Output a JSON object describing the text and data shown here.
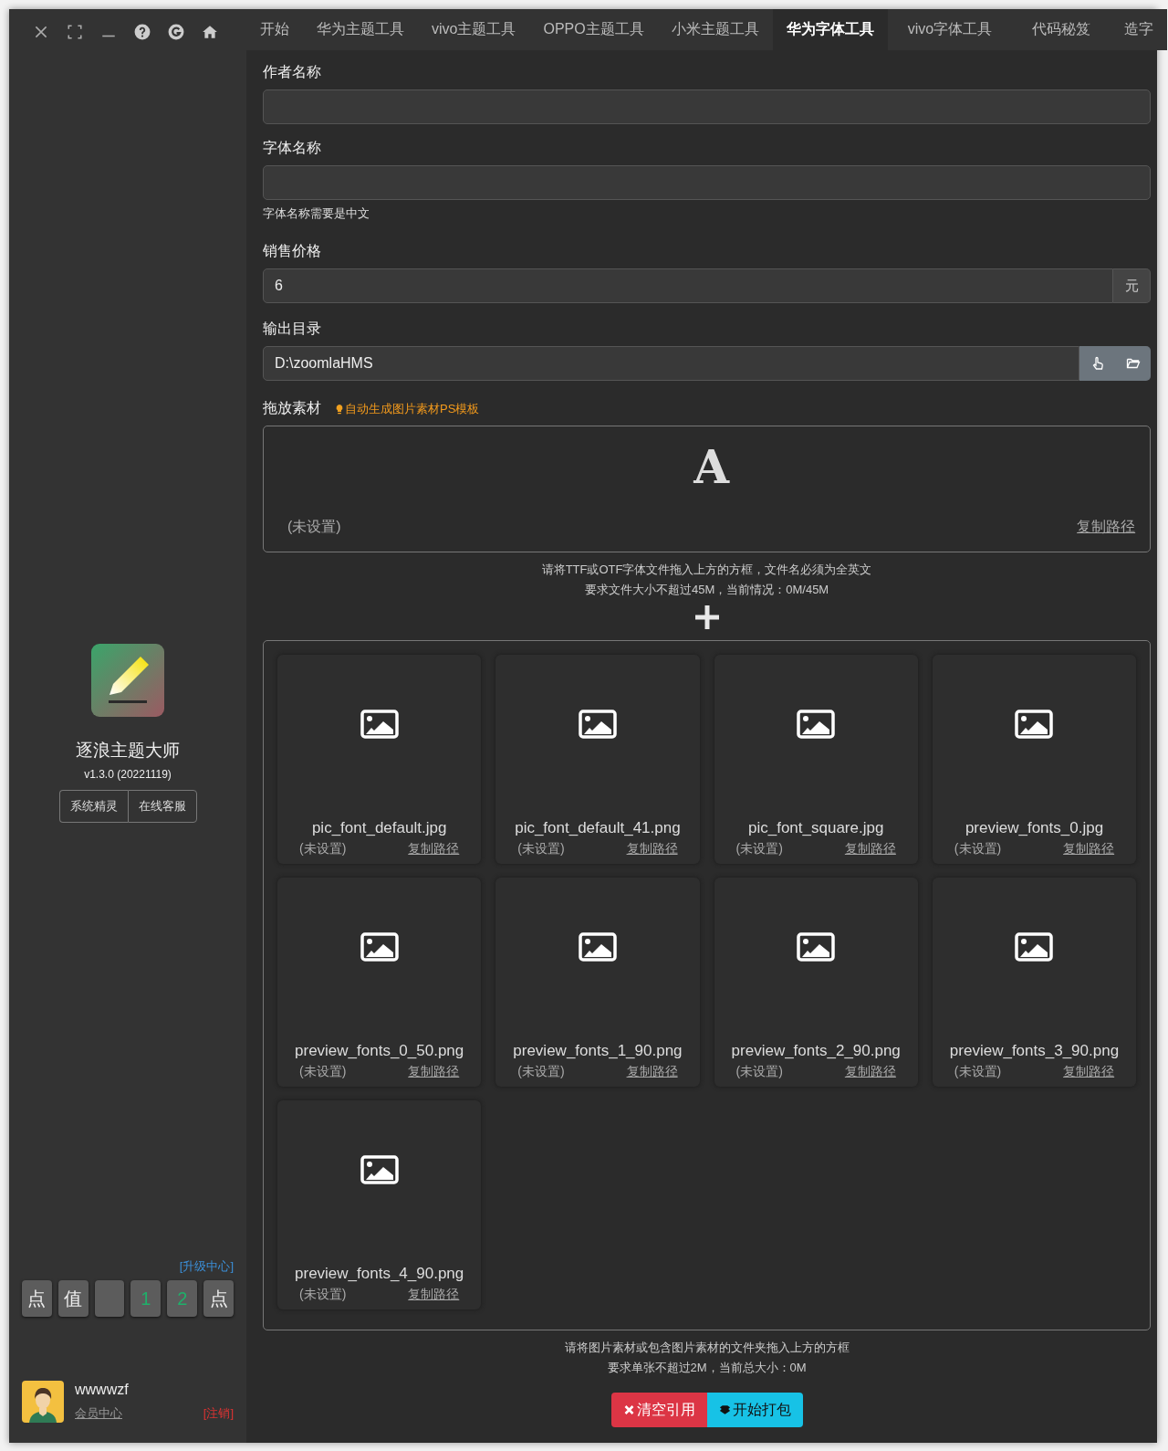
{
  "window_controls": [
    {
      "kind": "close"
    },
    {
      "kind": "fullscreen"
    },
    {
      "kind": "minimize"
    },
    {
      "kind": "help"
    },
    {
      "kind": "g"
    },
    {
      "kind": "home"
    }
  ],
  "sidebar": {
    "app_name": "逐浪主题大师",
    "version": "v1.3.0 (20221119)",
    "buttons": [
      "系统精灵",
      "在线客服"
    ],
    "upgrade_link": "[升级中心]",
    "keys": [
      {
        "kind": "char",
        "text": "点"
      },
      {
        "kind": "char",
        "text": "值"
      },
      {
        "kind": "blank"
      },
      {
        "kind": "digit",
        "text": "1"
      },
      {
        "kind": "digit",
        "text": "2"
      },
      {
        "kind": "char",
        "text": "点"
      }
    ],
    "user": {
      "name": "wwwwzf",
      "member_link": "会员中心",
      "logout_link": "[注销]"
    }
  },
  "tabs": [
    {
      "label": "开始",
      "selected": false
    },
    {
      "label": "华为主题工具",
      "selected": false
    },
    {
      "label": "vivo主题工具",
      "selected": false
    },
    {
      "label": "OPPO主题工具",
      "selected": false
    },
    {
      "label": "小米主题工具",
      "selected": false
    },
    {
      "label": "华为字体工具",
      "selected": true
    },
    {
      "label": "vivo字体工具",
      "selected": false
    },
    {
      "label": "代码秘笈",
      "selected": false
    },
    {
      "label": "造字",
      "selected": false
    }
  ],
  "form": [
    {
      "kind": "text",
      "label": "作者名称"
    },
    {
      "kind": "text",
      "label": "字体名称",
      "hint": "字体名称需要是中文"
    },
    {
      "kind": "suffix",
      "label": "销售价格",
      "value": "6",
      "suffix": "元"
    },
    {
      "kind": "path",
      "label": "输出目录",
      "value": "D:\\zoomlaHMS"
    }
  ],
  "font_drop": {
    "label": "拖放素材",
    "template_link": "自动生成图片素材PS模板",
    "glyph": "A",
    "status": "(未设置)",
    "copy_link": "复制路径",
    "hints": [
      "请将TTF或OTF字体文件拖入上方的方框，文件名必须为全英文",
      "要求文件大小不超过45M，当前情况：0M/45M"
    ]
  },
  "images": [
    {
      "file": "pic_font_default.jpg",
      "status": "(未设置)",
      "copy_link": "复制路径"
    },
    {
      "file": "pic_font_default_41.png",
      "status": "(未设置)",
      "copy_link": "复制路径"
    },
    {
      "file": "pic_font_square.jpg",
      "status": "(未设置)",
      "copy_link": "复制路径"
    },
    {
      "file": "preview_fonts_0.jpg",
      "status": "(未设置)",
      "copy_link": "复制路径"
    },
    {
      "file": "preview_fonts_0_50.png",
      "status": "(未设置)",
      "copy_link": "复制路径"
    },
    {
      "file": "preview_fonts_1_90.png",
      "status": "(未设置)",
      "copy_link": "复制路径"
    },
    {
      "file": "preview_fonts_2_90.png",
      "status": "(未设置)",
      "copy_link": "复制路径"
    },
    {
      "file": "preview_fonts_3_90.png",
      "status": "(未设置)",
      "copy_link": "复制路径"
    },
    {
      "file": "preview_fonts_4_90.png",
      "status": "(未设置)",
      "copy_link": "复制路径"
    }
  ],
  "image_hints": [
    "请将图片素材或包含图片素材的文件夹拖入上方的方框",
    "要求单张不超过2M，当前总大小：0M"
  ],
  "actions": [
    {
      "kind": "clear",
      "label": "清空引用"
    },
    {
      "kind": "pack",
      "label": "开始打包"
    }
  ]
}
